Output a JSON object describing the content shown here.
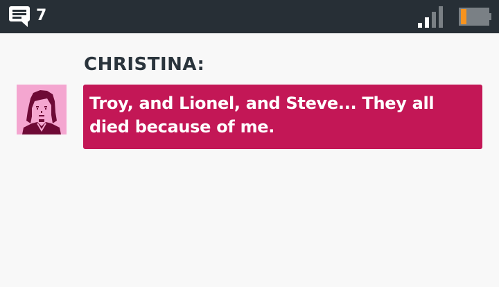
{
  "status_bar": {
    "message_icon": "chat-bubble-icon",
    "message_count": "7",
    "signal_icon": "signal-strength-icon",
    "signal_level": 0.5,
    "battery_icon": "battery-icon",
    "battery_level": 0.15,
    "colors": {
      "background": "#272f36",
      "battery_charge": "#f7931e"
    }
  },
  "dialogue": {
    "speaker": "CHRISTINA:",
    "avatar_icon": "christina-portrait-icon",
    "text": "Troy, and Lionel, and Steve... They all died because of me.",
    "colors": {
      "bubble": "#c31756",
      "avatar_background": "#f4a6d0",
      "avatar_ink": "#6e0a36"
    }
  }
}
